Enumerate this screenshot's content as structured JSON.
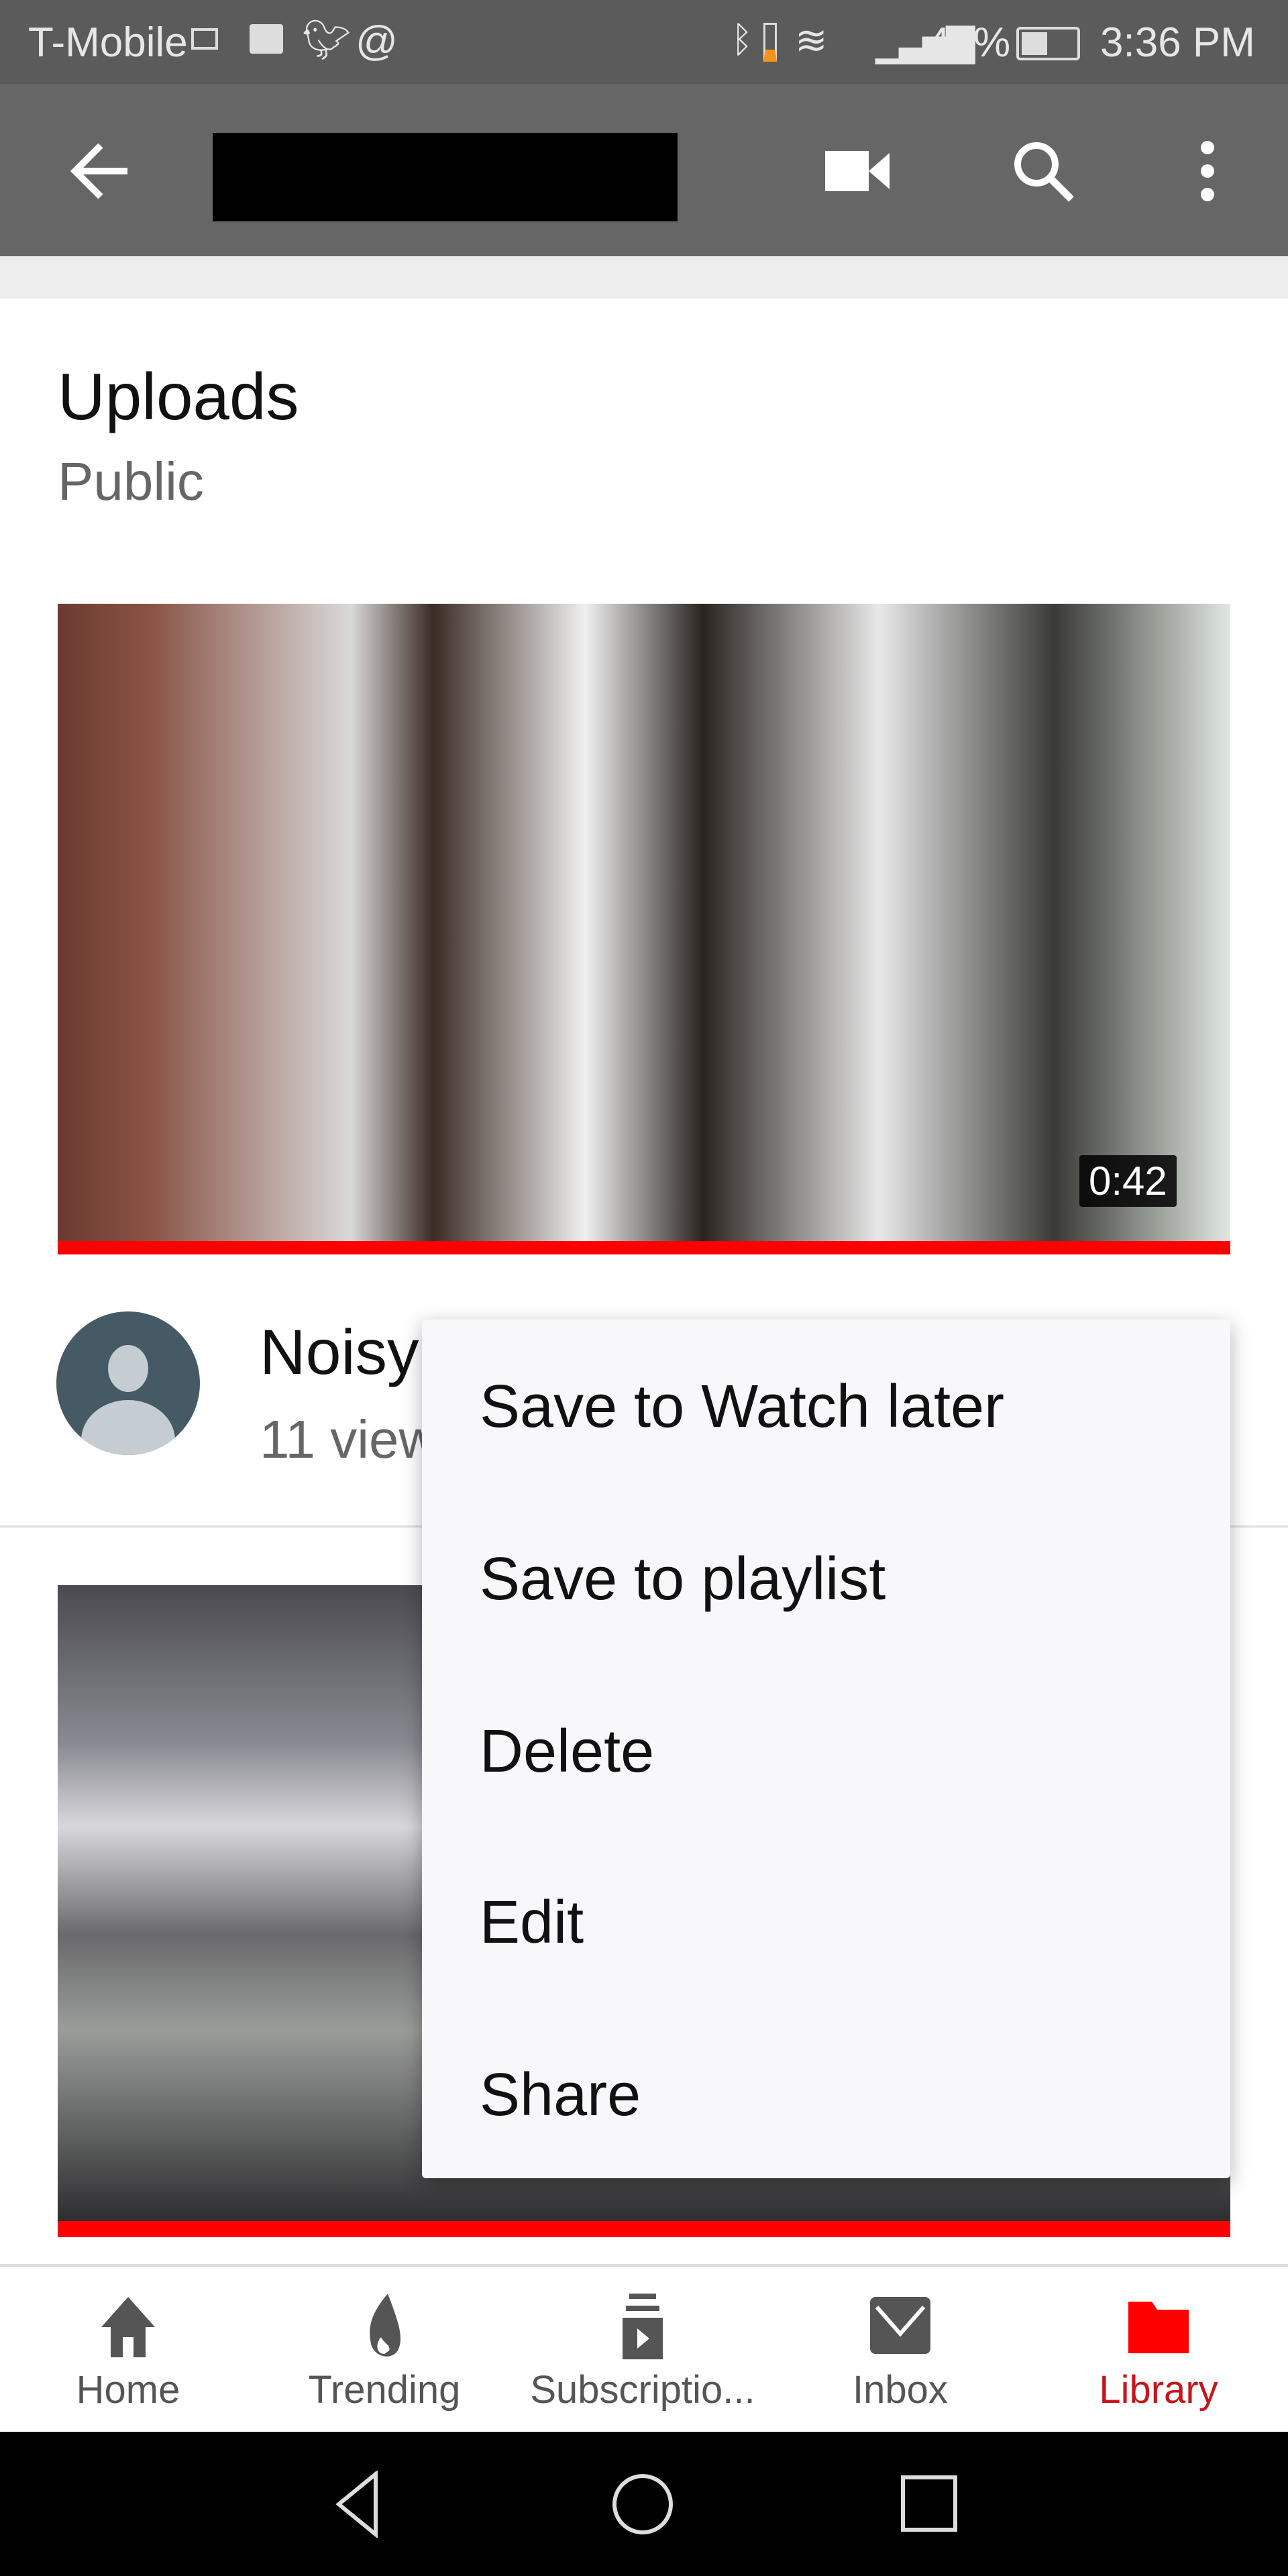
{
  "status_bar": {
    "carrier": "T-Mobile",
    "battery": "44%",
    "time": "3:36 PM",
    "icons": [
      "sim-icon",
      "activity-icon",
      "twitter-icon",
      "at-icon",
      "bluetooth-icon",
      "phone-battery-icon",
      "wifi-icon",
      "signal-icon",
      "battery-icon"
    ]
  },
  "app_bar": {
    "icons": [
      "back-arrow-icon",
      "video-camera-icon",
      "search-icon",
      "more-vert-icon"
    ]
  },
  "section": {
    "title": "Uploads",
    "subtitle": "Public"
  },
  "videos": [
    {
      "title": "Noisy",
      "meta": "11 view",
      "duration": "0:42"
    },
    {
      "title": "",
      "meta": "",
      "duration": ""
    }
  ],
  "menu": {
    "items": [
      "Save to Watch later",
      "Save to playlist",
      "Delete",
      "Edit",
      "Share"
    ]
  },
  "bottom_nav": {
    "items": [
      {
        "label": "Home",
        "icon": "home-icon"
      },
      {
        "label": "Trending",
        "icon": "flame-icon"
      },
      {
        "label": "Subscriptio...",
        "icon": "subscriptions-icon"
      },
      {
        "label": "Inbox",
        "icon": "mail-icon"
      },
      {
        "label": "Library",
        "icon": "folder-icon",
        "active": true
      }
    ],
    "active_color": "#ff0000"
  },
  "system_nav": {
    "icons": [
      "back-triangle-icon",
      "home-circle-icon",
      "recents-square-icon"
    ]
  }
}
